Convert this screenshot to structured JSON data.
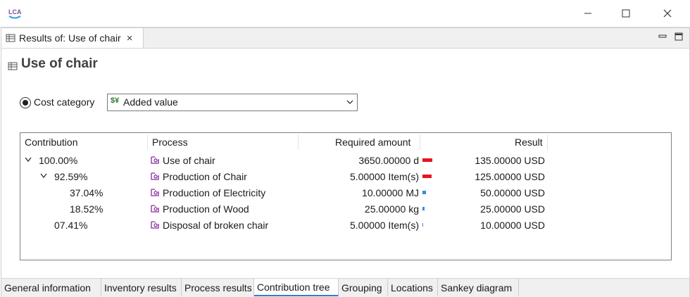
{
  "app": {
    "logo_text": "LCA"
  },
  "editor_tab": {
    "label": "Results of: Use of chair",
    "close_glyph": "×"
  },
  "page": {
    "title": "Use of chair"
  },
  "selector": {
    "radio_label": "Cost category",
    "radio_selected": true,
    "combo_icon": "$¥",
    "combo_value": "Added value"
  },
  "table": {
    "headers": [
      "Contribution",
      "Process",
      "Required amount",
      "Result"
    ],
    "rows": [
      {
        "contribution": "100.00%",
        "process": "Use of chair",
        "amount": "3650.00000 d",
        "result": "135.00000 USD",
        "level": 0,
        "expanded": true,
        "share": 1.0,
        "bar_color": "#e8141c"
      },
      {
        "contribution": "92.59%",
        "process": "Production of Chair",
        "amount": "5.00000 Item(s)",
        "result": "125.00000 USD",
        "level": 1,
        "expanded": true,
        "share": 0.9259,
        "bar_color": "#e8141c"
      },
      {
        "contribution": "37.04%",
        "process": "Production of Electricity",
        "amount": "10.00000 MJ",
        "result": "50.00000 USD",
        "level": 2,
        "expanded": false,
        "share": 0.3704,
        "bar_color": "#3a8bd8"
      },
      {
        "contribution": "18.52%",
        "process": "Production of Wood",
        "amount": "25.00000 kg",
        "result": "25.00000 USD",
        "level": 2,
        "expanded": false,
        "share": 0.1852,
        "bar_color": "#3a8bd8"
      },
      {
        "contribution": "07.41%",
        "process": "Disposal of broken chair",
        "amount": "5.00000 Item(s)",
        "result": "10.00000 USD",
        "level": 1,
        "expanded": false,
        "share": 0.0741,
        "bar_color": "#3a8bd8"
      }
    ]
  },
  "bottom_tabs": {
    "items": [
      "General information",
      "Inventory results",
      "Process results",
      "Contribution tree",
      "Grouping",
      "Locations",
      "Sankey diagram"
    ],
    "active": "Contribution tree"
  },
  "colors": {
    "accent": "#3b78c4",
    "process_icon": "#8a2a9e",
    "bar_high": "#e8141c",
    "bar_low": "#3a8bd8"
  }
}
